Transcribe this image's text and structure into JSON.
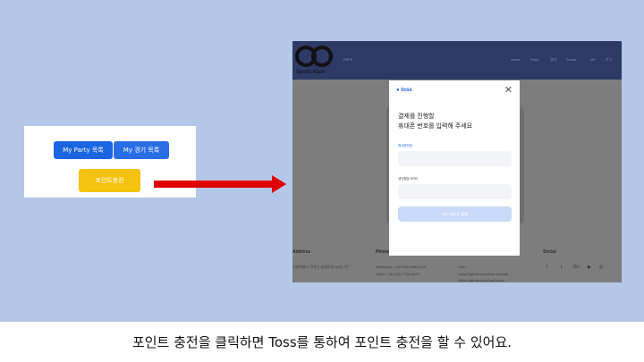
{
  "left_card": {
    "party_button": "My Party 목록",
    "game_button": "My 경기 목록",
    "point_button": "포인트충전"
  },
  "screenshot": {
    "brand": "Sports Mate",
    "nav_left": "스포츠",
    "nav_items": [
      "Home",
      "Party",
      "경기",
      "Social",
      "MY",
      "로그"
    ],
    "footer": {
      "address_title": "Address",
      "address_text": "서울특별시 강북구 삼양로로 38길 7번",
      "phone_title": "Phone",
      "phone_lines": [
        "Reception : +82 010-5556-1123",
        "Office : +82 (10) 7753-4413"
      ],
      "site_lines": [
        "Site :",
        "https://github.com/Han-Seoade",
        "https://github.com/Lae.bocca"
      ],
      "social_title": "Social",
      "social_icons": [
        "f",
        "t",
        "G+",
        "▶",
        "◎"
      ]
    },
    "modal": {
      "logo": "● toss",
      "close": "✕",
      "title_line1": "결제를 진행할",
      "title_line2": "휴대폰 번호를 입력해 주세요",
      "phone_label": "휴대폰번호",
      "birth_label": "생년월일 6자리",
      "submit": "토스 앱으로 결제"
    }
  },
  "caption": "포인트 충전을 클릭하면 Toss를 통하여 포인트 충전을 할 수 있어요.",
  "colors": {
    "slide_bg": "#b4c7e7",
    "arrow": "#e00000",
    "primary_blue": "#1b66e0",
    "point_yellow": "#f5c20f",
    "toss_blue": "#1b64da"
  }
}
